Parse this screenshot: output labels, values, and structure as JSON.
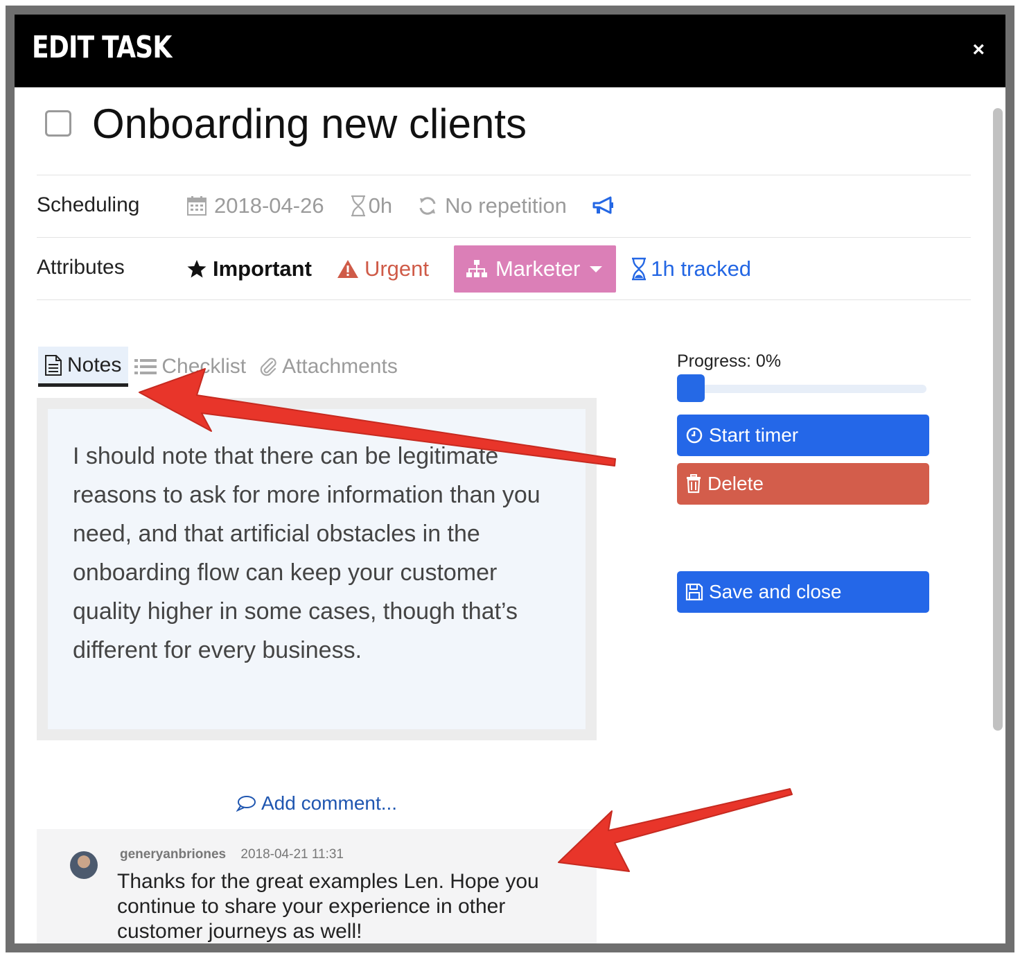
{
  "header": {
    "title": "EDIT TASK",
    "close_label": "×"
  },
  "task": {
    "title": "Onboarding new clients",
    "completed": false
  },
  "scheduling": {
    "label": "Scheduling",
    "date": "2018-04-26",
    "duration": "0h",
    "repetition": "No repetition",
    "icons": [
      "calendar-icon",
      "hourglass-icon",
      "refresh-icon",
      "megaphone-icon"
    ]
  },
  "attributes": {
    "label": "Attributes",
    "important": "Important",
    "urgent": "Urgent",
    "role": "Marketer",
    "tracked": "1h tracked"
  },
  "tabs": [
    {
      "label": "Notes",
      "icon": "document-icon",
      "active": true
    },
    {
      "label": "Checklist",
      "icon": "list-icon",
      "active": false
    },
    {
      "label": "Attachments",
      "icon": "paperclip-icon",
      "active": false
    }
  ],
  "notes": {
    "text": "I should note that there can be legitimate reasons to ask for more information than you need, and that artificial obstacles in the onboarding flow can keep your customer quality higher in some cases, though that’s different for every business."
  },
  "progress": {
    "label": "Progress: 0%",
    "value": 0
  },
  "actions": {
    "start_timer": "Start timer",
    "delete": "Delete",
    "save_close": "Save and close"
  },
  "comments": {
    "add_label": "Add comment...",
    "items": [
      {
        "user": "generyanbriones",
        "timestamp": "2018-04-21 11:31",
        "text": "Thanks for the great examples Len. Hope you continue to share your experience in other customer journeys as well!"
      }
    ]
  },
  "colors": {
    "primary": "#2467e8",
    "danger": "#d35d4b",
    "urgent": "#cf5b48",
    "role_badge": "#db7fb7",
    "annotation_arrow": "#e8352a"
  }
}
